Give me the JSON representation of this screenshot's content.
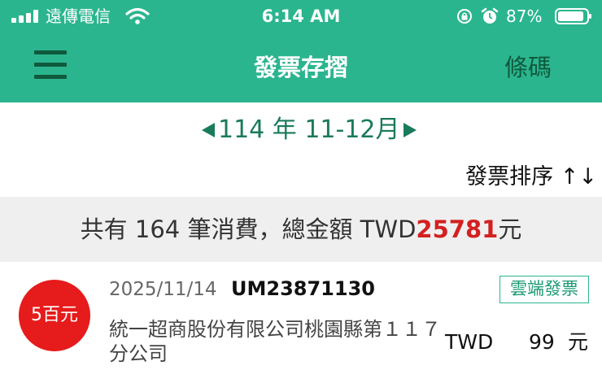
{
  "status_bar": {
    "carrier": "遠傳電信",
    "time": "6:14 AM",
    "battery_percent": "87%",
    "icons": [
      "signal-icon",
      "wifi-icon",
      "orientation-lock-icon",
      "alarm-icon",
      "battery-icon"
    ]
  },
  "header": {
    "title": "發票存摺",
    "barcode_label": "條碼",
    "menu_icon": "hamburger-menu-icon"
  },
  "period": {
    "label": "114 年 11-12月",
    "prev_icon": "triangle-left-icon",
    "next_icon": "triangle-right-icon"
  },
  "sort": {
    "label": "發票排序 ↑↓"
  },
  "summary": {
    "prefix": "共有 164 筆消費，總金額 TWD",
    "amount": "25781",
    "suffix": "元"
  },
  "invoices": [
    {
      "prize": "5百元",
      "date": "2025/11/14",
      "number": "UM23871130",
      "tag": "雲端發票",
      "store": "統一超商股份有限公司桃園縣第１１７分公司",
      "currency": "TWD",
      "amount": "99",
      "unit": "元"
    }
  ],
  "colors": {
    "brand_green": "#2bb58f",
    "dark_green": "#0f5a3c",
    "period_green": "#1a7a5c",
    "summary_red": "#d42020",
    "prize_red": "#e61b1b"
  }
}
